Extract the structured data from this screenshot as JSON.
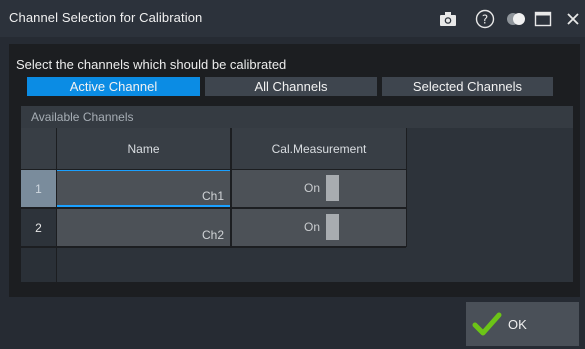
{
  "window": {
    "title": "Channel Selection for Calibration",
    "icons": [
      "camera-icon",
      "help-icon",
      "toggle-transparency-icon",
      "maximize-icon",
      "close-icon"
    ]
  },
  "prompt": "Select the channels which should be calibrated",
  "channel_buttons": [
    {
      "label": "Active Channel",
      "active": true
    },
    {
      "label": "All Channels",
      "active": false
    },
    {
      "label": "Selected Channels",
      "active": false
    }
  ],
  "available": {
    "title": "Available Channels",
    "columns": [
      "Name",
      "Cal.Measurement"
    ],
    "rows": [
      {
        "index": "1",
        "name": "Ch1",
        "cal": "On",
        "selected": true
      },
      {
        "index": "2",
        "name": "Ch2",
        "cal": "On",
        "selected": false
      }
    ]
  },
  "ok_button": {
    "label": "OK"
  },
  "colors": {
    "accent": "#0b8ce4",
    "ok_check": "#6cc417",
    "selected_row_header": "#7a8c9c",
    "focus_underline": "#1aa0ff"
  }
}
